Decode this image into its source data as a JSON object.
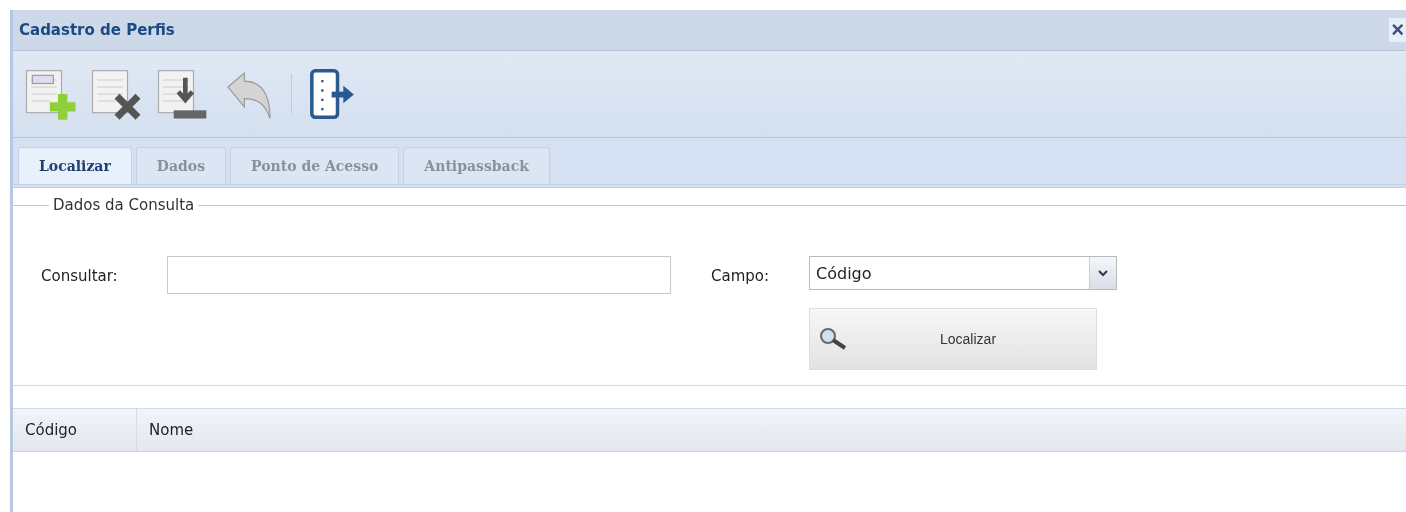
{
  "window": {
    "title": "Cadastro de Perfis",
    "close": "×"
  },
  "toolbar": [
    {
      "kind": "new"
    },
    {
      "kind": "delete"
    },
    {
      "kind": "save"
    },
    {
      "kind": "undo"
    },
    {
      "kind": "separator"
    },
    {
      "kind": "exit"
    }
  ],
  "tabs": [
    {
      "label": "Localizar",
      "selected": true,
      "disabled": false
    },
    {
      "label": "Dados",
      "selected": false,
      "disabled": true
    },
    {
      "label": "Ponto de Acesso",
      "selected": false,
      "disabled": true
    },
    {
      "label": "Antipassback",
      "selected": false,
      "disabled": true
    }
  ],
  "query": {
    "legend": "Dados da Consulta",
    "search_label": "Consultar:",
    "field_label": "Campo:",
    "field_value": "Código",
    "button": "Localizar"
  },
  "table": {
    "columns": [
      "Código",
      "Nome"
    ]
  }
}
